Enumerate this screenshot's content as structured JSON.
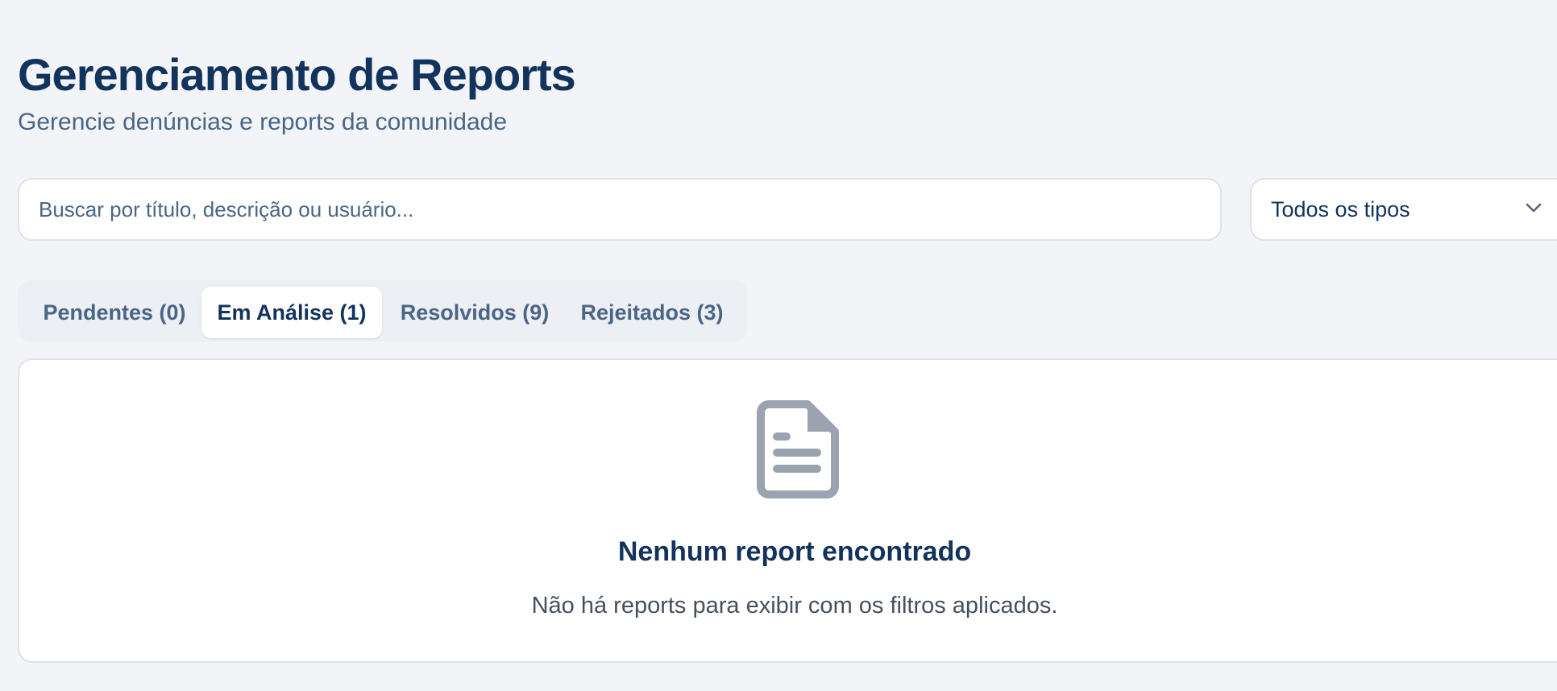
{
  "header": {
    "title": "Gerenciamento de Reports",
    "subtitle": "Gerencie denúncias e reports da comunidade"
  },
  "filters": {
    "search": {
      "value": "",
      "placeholder": "Buscar por título, descrição ou usuário..."
    },
    "type_select": {
      "selected": "Todos os tipos",
      "icon": "chevron-down-icon"
    }
  },
  "tabs": [
    {
      "label": "Pendentes (0)",
      "active": false
    },
    {
      "label": "Em Análise (1)",
      "active": true
    },
    {
      "label": "Resolvidos (9)",
      "active": false
    },
    {
      "label": "Rejeitados (3)",
      "active": false
    }
  ],
  "empty_state": {
    "icon": "document-icon",
    "title": "Nenhum report encontrado",
    "message": "Não há reports para exibir com os filtros aplicados."
  },
  "colors": {
    "background": "#f2f4f7",
    "title": "#12335c",
    "muted_text": "#4a6585",
    "icon": "#9ba3af",
    "card": "#ffffff",
    "border": "#dde2e9"
  }
}
